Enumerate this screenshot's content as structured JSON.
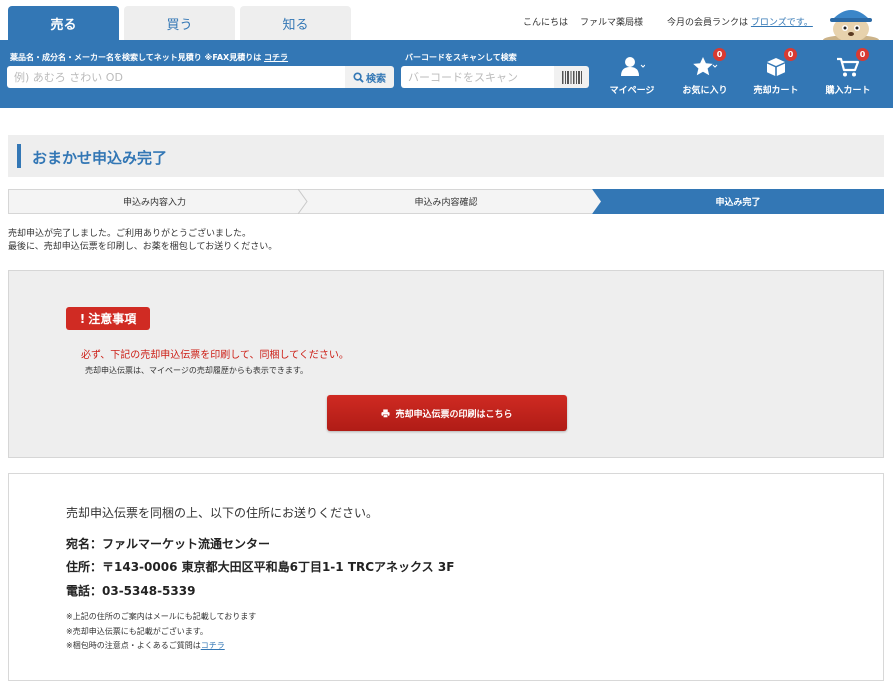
{
  "tabs": [
    {
      "label": "売る",
      "active": true
    },
    {
      "label": "買う",
      "active": false
    },
    {
      "label": "知る",
      "active": false
    }
  ],
  "greeting": {
    "hello": "こんにちは",
    "user": "ファルマ薬局様",
    "rank_prefix": "今月の会員ランクは",
    "rank_link": "ブロンズです。"
  },
  "search": {
    "label": "薬品名・成分名・メーカー名を検索してネット見積り ※FAX見積りは",
    "label_link": "コチラ",
    "placeholder": "例) あむろ さわい OD",
    "button_label": "検索"
  },
  "barcode": {
    "label": "バーコードをスキャンして検索",
    "placeholder": "バーコードをスキャン"
  },
  "nav": [
    {
      "label": "マイページ",
      "icon": "user-icon",
      "badge": null
    },
    {
      "label": "お気に入り",
      "icon": "star-icon",
      "badge": "0"
    },
    {
      "label": "売却カート",
      "icon": "box-icon",
      "badge": "0"
    },
    {
      "label": "購入カート",
      "icon": "cart-icon",
      "badge": "0"
    }
  ],
  "page_title": "おまかせ申込み完了",
  "steps": [
    {
      "label": "申込み内容入力",
      "active": false
    },
    {
      "label": "申込み内容確認",
      "active": false
    },
    {
      "label": "申込み完了",
      "active": true
    }
  ],
  "message": {
    "line1": "売却申込が完了しました。ご利用ありがとうございました。",
    "line2": "最後に、売却申込伝票を印刷し、お薬を梱包してお送りください。"
  },
  "notice": {
    "badge": "注意事項",
    "warning": "必ず、下記の売却申込伝票を印刷して、同梱してください。",
    "sub": "売却申込伝票は、マイページの売却履歴からも表示できます。",
    "button_label": "売却申込伝票の印刷はこちら"
  },
  "address": {
    "intro": "売却申込伝票を同梱の上、以下の住所にお送りください。",
    "name": "宛名：ファルマーケット流通センター",
    "address": "住所：〒143-0006 東京都大田区平和島6丁目1-1 TRCアネックス 3F",
    "phone": "電話：03-5348-5339",
    "note1": "※上記の住所のご案内はメールにも記載しております",
    "note2": "※売却申込伝票にも記載がございます。",
    "note3": "※梱包時の注意点・よくあるご質問は",
    "note3_link": "コチラ"
  },
  "colors": {
    "primary": "#3377b5",
    "alert": "#d02b23",
    "badge": "#d83a32"
  }
}
